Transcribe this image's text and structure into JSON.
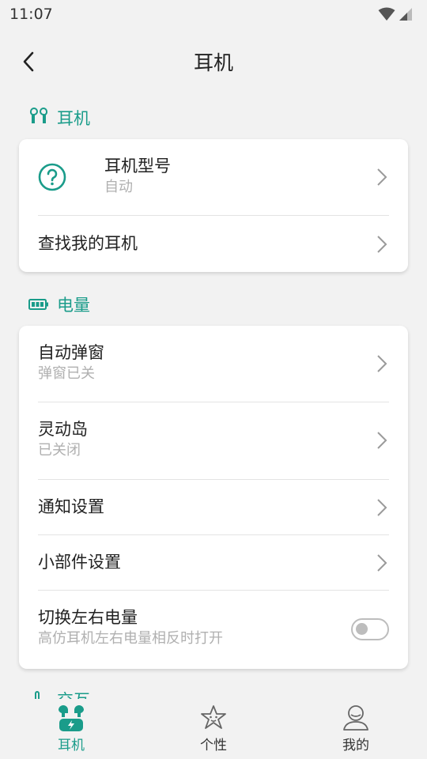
{
  "status": {
    "time": "11:07"
  },
  "app_bar": {
    "title": "耳机"
  },
  "sections": {
    "earphone": {
      "title": "耳机"
    },
    "battery": {
      "title": "电量"
    },
    "interaction": {
      "title": "交互"
    }
  },
  "earphone_card": {
    "model_label": "耳机型号",
    "model_value": "自动",
    "find_label": "查找我的耳机"
  },
  "battery_card": {
    "popup_label": "自动弹窗",
    "popup_value": "弹窗已关",
    "island_label": "灵动岛",
    "island_value": "已关闭",
    "notify_label": "通知设置",
    "widget_label": "小部件设置",
    "swap_label": "切换左右电量",
    "swap_desc": "高仿耳机左右电量相反时打开",
    "swap_enabled": false
  },
  "bottom_nav": {
    "items": [
      {
        "label": "耳机",
        "icon": "earbuds-icon",
        "active": true
      },
      {
        "label": "个性",
        "icon": "star-icon",
        "active": false
      },
      {
        "label": "我的",
        "icon": "profile-icon",
        "active": false
      }
    ]
  },
  "colors": {
    "accent": "#1a9c8a",
    "background": "#f2f2f2",
    "card": "#ffffff"
  }
}
